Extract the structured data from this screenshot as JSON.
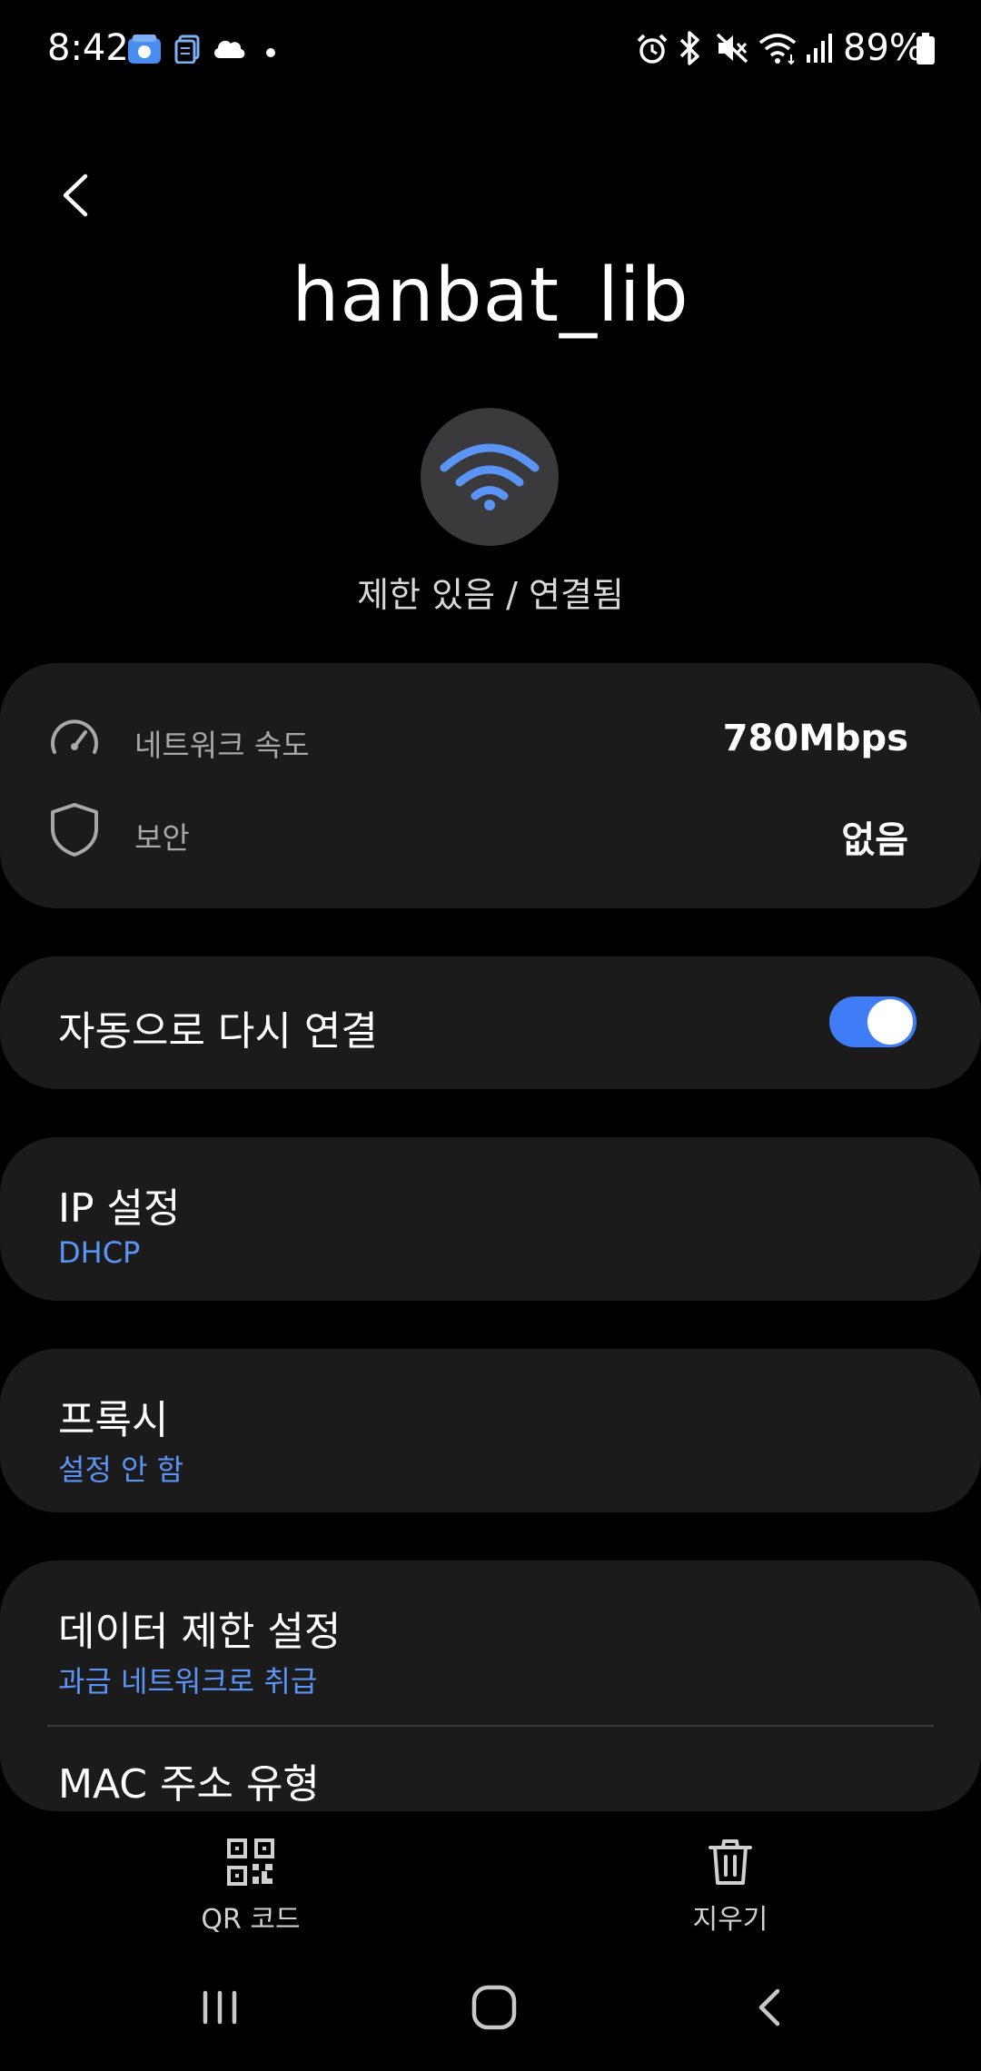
{
  "status_bar": {
    "time": "8:42",
    "battery": "89%",
    "icons": [
      "gallery-icon",
      "files-icon",
      "cloud-icon",
      "dot-icon",
      "alarm-icon",
      "bluetooth-icon",
      "mute-icon",
      "wifi-icon",
      "signal-icon",
      "battery-icon"
    ]
  },
  "header": {
    "title": "hanbat_lib",
    "status": "제한 있음 / 연결됨"
  },
  "info": {
    "speed_label": "네트워크 속도",
    "speed_value": "780Mbps",
    "security_label": "보안",
    "security_value": "없음"
  },
  "auto_reconnect": {
    "label": "자동으로 다시 연결",
    "enabled": true
  },
  "ip_settings": {
    "title": "IP 설정",
    "value": "DHCP"
  },
  "proxy": {
    "title": "프록시",
    "value": "설정 안 함"
  },
  "data_limit": {
    "title": "데이터 제한 설정",
    "value": "과금 네트워크로 취급"
  },
  "mac": {
    "title": "MAC 주소 유형"
  },
  "actions": {
    "qr_label": "QR 코드",
    "delete_label": "지우기"
  },
  "colors": {
    "accent": "#3e7df5",
    "link": "#5a94f5",
    "card": "#1b1b1b",
    "background": "#000000"
  }
}
